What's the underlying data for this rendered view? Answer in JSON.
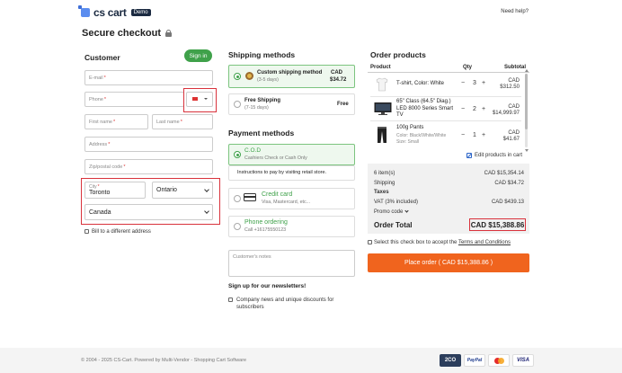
{
  "header": {
    "logo_text": "cs cart",
    "demo_badge": "Demo",
    "need_help": "Need help?",
    "page_title": "Secure checkout"
  },
  "customer": {
    "title": "Customer",
    "sign_in": "Sign in",
    "email_placeholder": "E-mail",
    "phone_placeholder": "Phone",
    "first_name_placeholder": "First name",
    "last_name_placeholder": "Last name",
    "address_placeholder": "Address",
    "zip_placeholder": "Zip/postal code",
    "city_label": "City",
    "city_value": "Toronto",
    "state_value": "Ontario",
    "country_value": "Canada",
    "bill_different": "Bill to a different address",
    "required_mark": "*"
  },
  "shipping": {
    "title": "Shipping methods",
    "methods": [
      {
        "name": "Custom shipping method",
        "days": "(3-5 days)",
        "price_line1": "CAD",
        "price_line2": "$34.72",
        "selected": true
      },
      {
        "name": "Free Shipping",
        "days": "(7-15 days)",
        "price": "Free",
        "selected": false
      }
    ]
  },
  "payment": {
    "title": "Payment methods",
    "cod_name": "C.O.D",
    "cod_desc": "Cashiers Check or Cash Only",
    "cod_instructions": "Instructions to pay by visiting retail store.",
    "credit_name": "Credit card",
    "credit_desc": "Visa, Mastercard, etc...",
    "phone_name": "Phone ordering",
    "phone_desc": "Call +16175550123",
    "notes_placeholder": "Customer's notes"
  },
  "newsletter": {
    "title": "Sign up for our newsletters!",
    "option": "Company news and unique discounts for subscribers"
  },
  "order": {
    "title": "Order products",
    "col_product": "Product",
    "col_qty": "Qty",
    "col_subtotal": "Subtotal",
    "items": [
      {
        "name": "T-shirt, Color: White",
        "qty": "3",
        "price_cur": "CAD",
        "price": "$312.50"
      },
      {
        "name": "65\" Class (64.5\" Diag.) LED 8000 Series Smart TV",
        "qty": "2",
        "price_cur": "CAD",
        "price": "$14,999.97"
      },
      {
        "name": "100g Pants",
        "meta1": "Color: Black/White/White",
        "meta2": "Size: Small",
        "qty": "1",
        "price_cur": "CAD",
        "price": "$41.67"
      }
    ],
    "minus": "−",
    "plus": "+",
    "edit_products": "Edit products in cart"
  },
  "summary": {
    "items_label": "6 item(s)",
    "items_value": "CAD $15,354.14",
    "shipping_label": "Shipping",
    "shipping_value": "CAD $34.72",
    "taxes_label": "Taxes",
    "vat_label": "VAT (3% included)",
    "vat_value": "CAD $439.13",
    "promo_label": "Promo code",
    "total_label": "Order Total",
    "total_value": "CAD $15,388.86"
  },
  "terms": {
    "prefix": "Select this check box to accept the ",
    "link": "Terms and Conditions"
  },
  "place_order": "Place order ( CAD $15,388.86 )",
  "footer": {
    "copyright": "© 2004 - 2025 CS-Cart.  Powered by Multi-Vendor - Shopping Cart Software",
    "pay_2co": "2CO",
    "pay_paypal": "PayPal",
    "pay_visa": "VISA"
  },
  "colors": {
    "accent_green": "#3fa14a",
    "accent_orange": "#f0641e",
    "highlight_red": "#d9323c",
    "link_blue": "#2a63c7"
  }
}
